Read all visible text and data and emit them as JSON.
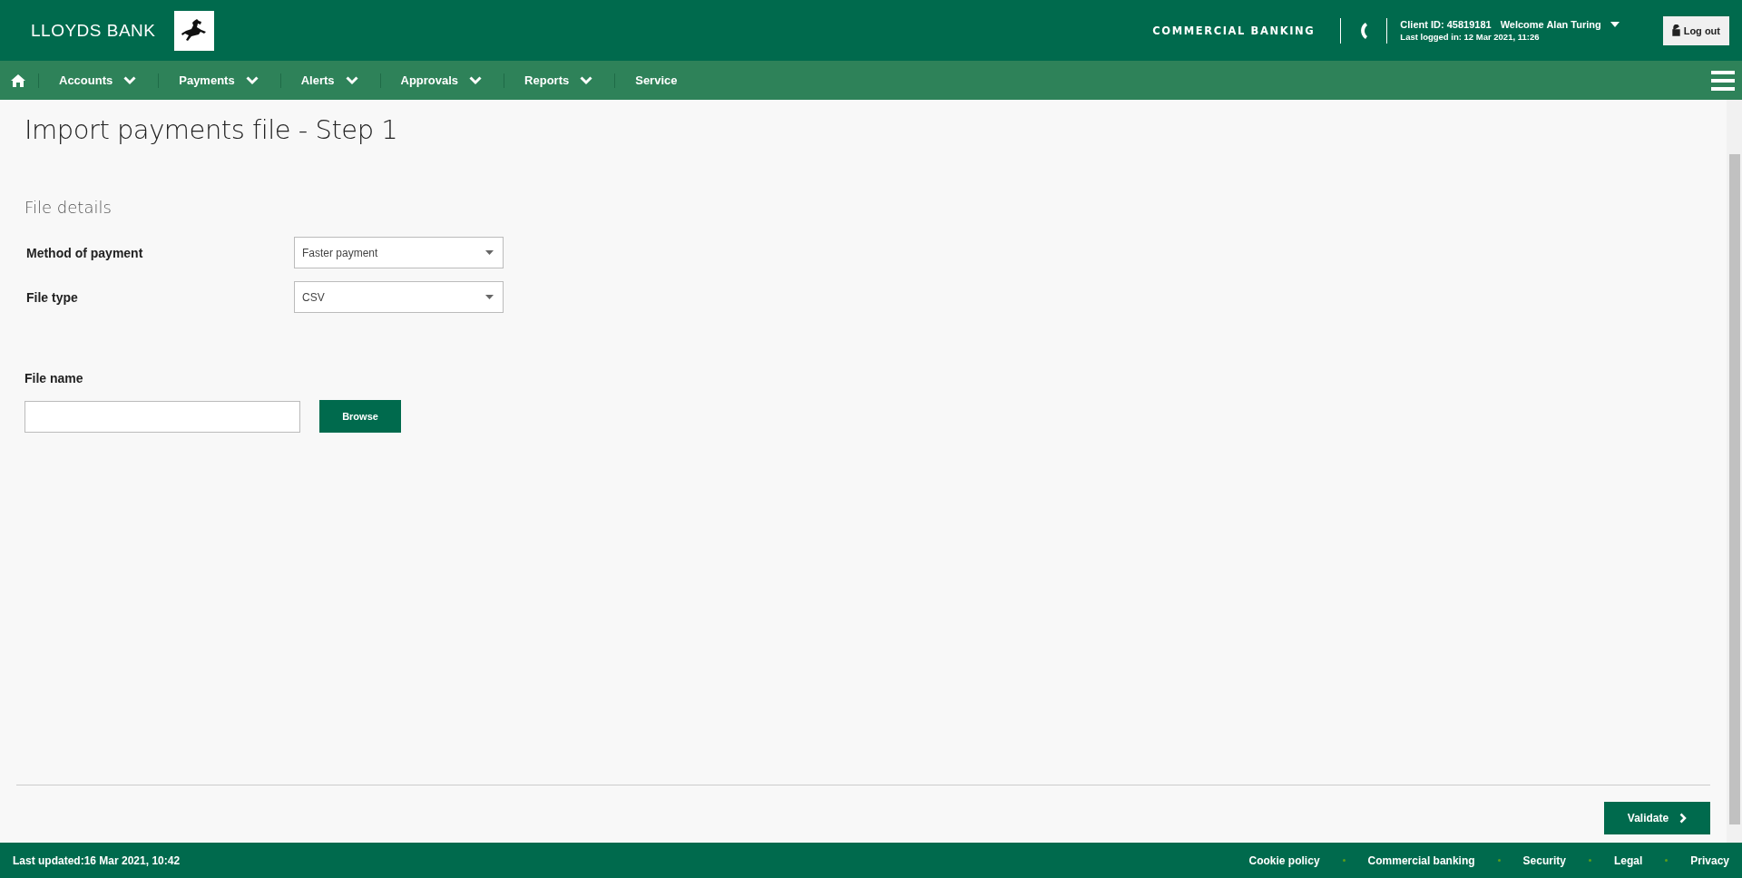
{
  "header": {
    "brand": "LLOYDS BANK",
    "segment": "COMMERCIAL BANKING",
    "client_id": "Client ID: 45819181",
    "welcome": "Welcome Alan Turing",
    "last_logged_in": "Last logged in: 12 Mar 2021, 11:26",
    "logout_button": "Log out"
  },
  "nav": {
    "items": [
      {
        "label": "Accounts",
        "kind": "dropdown"
      },
      {
        "label": "Payments",
        "kind": "dropdown"
      },
      {
        "label": "Alerts",
        "kind": "dropdown"
      },
      {
        "label": "Approvals",
        "kind": "dropdown"
      },
      {
        "label": "Reports",
        "kind": "dropdown"
      },
      {
        "label": "Service",
        "kind": "link"
      }
    ]
  },
  "page": {
    "title": "Import payments file - Step 1",
    "section": "File details",
    "fields": [
      {
        "label": "Method of payment",
        "value": "Faster payment"
      },
      {
        "label": "File type",
        "value": "CSV"
      }
    ],
    "file_name": {
      "label": "File name",
      "button": "Browse"
    },
    "validate_button": "Validate"
  },
  "footer": {
    "last_updated": "Last updated:16 Mar 2021, 10:42",
    "links": [
      "Cookie policy",
      "Commercial banking",
      "Security",
      "Legal",
      "Privacy"
    ]
  }
}
